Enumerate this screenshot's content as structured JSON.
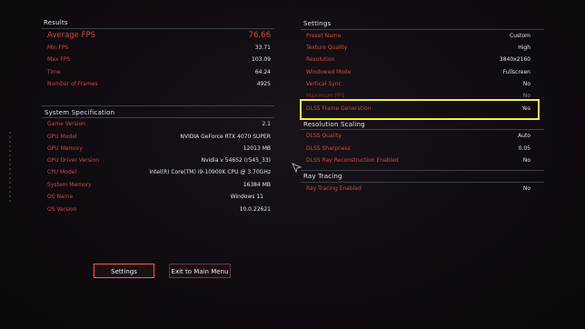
{
  "results": {
    "title": "Results",
    "rows": [
      {
        "label": "Average FPS",
        "value": "76.66"
      },
      {
        "label": "Min FPS",
        "value": "33.71"
      },
      {
        "label": "Max FPS",
        "value": "103.09"
      },
      {
        "label": "Time",
        "value": "64.24"
      },
      {
        "label": "Number of Frames",
        "value": "4925"
      }
    ]
  },
  "system": {
    "title": "System Specification",
    "rows": [
      {
        "label": "Game Version",
        "value": "2.1"
      },
      {
        "label": "GPU Model",
        "value": "NVIDIA GeForce RTX 4070 SUPER"
      },
      {
        "label": "GPU Memory",
        "value": "12013 MB"
      },
      {
        "label": "GPU Driver Version",
        "value": "Nvidia v 54652 (r545_33)"
      },
      {
        "label": "CPU Model",
        "value": "Intel(R) Core(TM) i9-10900K CPU @ 3.70GHz"
      },
      {
        "label": "System Memory",
        "value": "16384 MB"
      },
      {
        "label": "OS Name",
        "value": "Windows 11"
      },
      {
        "label": "OS Version",
        "value": "10.0.22621"
      }
    ]
  },
  "settings": {
    "title": "Settings",
    "rows": [
      {
        "label": "Preset Name",
        "value": "Custom"
      },
      {
        "label": "Texture Quality",
        "value": "High"
      },
      {
        "label": "Resolution",
        "value": "3840x2160"
      },
      {
        "label": "Windowed Mode",
        "value": "Fullscreen"
      },
      {
        "label": "Vertical Sync",
        "value": "No"
      },
      {
        "label": "Maximum FPS",
        "value": "No"
      },
      {
        "label": "DLSS Frame Generation",
        "value": "Yes"
      }
    ]
  },
  "scaling": {
    "title": "Resolution Scaling",
    "rows": [
      {
        "label": "DLSS Quality",
        "value": "Auto"
      },
      {
        "label": "DLSS Sharpness",
        "value": "0.05"
      },
      {
        "label": "DLSS Ray Reconstruction Enabled",
        "value": "No"
      }
    ]
  },
  "raytracing": {
    "title": "Ray Tracing",
    "rows": [
      {
        "label": "Ray Tracing Enabled",
        "value": "No"
      }
    ]
  },
  "buttons": {
    "settings": "Settings",
    "exit": "Exit to Main Menu"
  },
  "colors": {
    "accent_red": "#d24a3b",
    "highlight_yellow": "#f2f04c",
    "button_active_border": "#ff5a4a"
  },
  "icons": {
    "cursor": "mouse-pointer-icon"
  }
}
